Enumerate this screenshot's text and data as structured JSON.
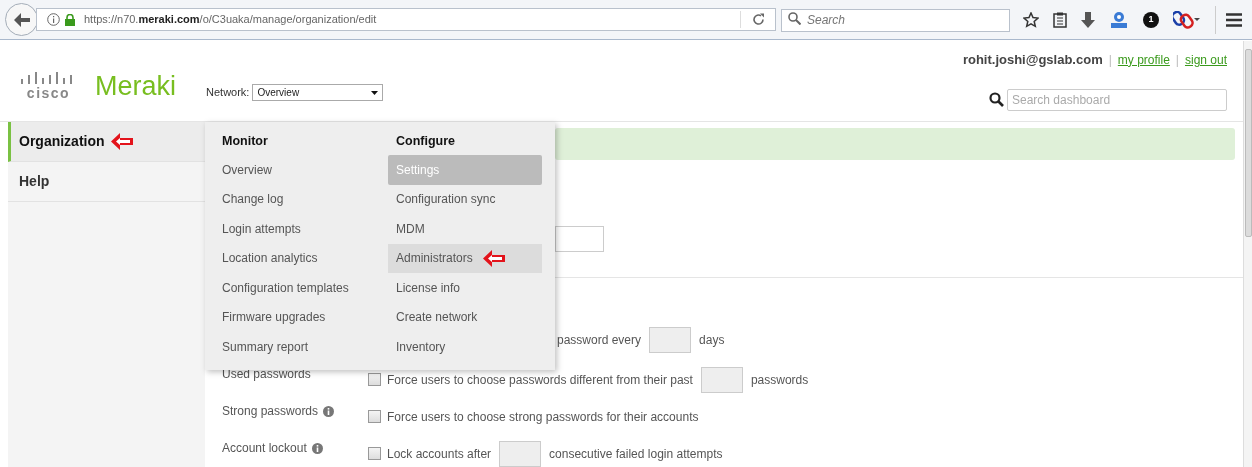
{
  "browser": {
    "url": "https://n70.**meraki.com**/o/C3uaka/manage/organization/edit",
    "search_placeholder": "Search",
    "badge": "1"
  },
  "header": {
    "logo_word": "cisco",
    "brand": "Meraki",
    "network_label": "Network:",
    "network_value": "Overview",
    "user": "rohit.joshi@gslab.com",
    "links": [
      {
        "separator": "|",
        "label": "my profile"
      },
      {
        "separator": "|",
        "label": "sign out"
      }
    ],
    "search_placeholder": "Search dashboard"
  },
  "sidebar": {
    "items": [
      {
        "label": "Organization",
        "selected": true,
        "annotated": true
      },
      {
        "label": "Help",
        "selected": false,
        "annotated": false
      }
    ]
  },
  "menu": {
    "columns": [
      {
        "heading": "Monitor",
        "items": [
          {
            "label": "Overview",
            "selected": false,
            "hovered": false,
            "annotated": false
          },
          {
            "label": "Change log",
            "selected": false,
            "hovered": false,
            "annotated": false
          },
          {
            "label": "Login attempts",
            "selected": false,
            "hovered": false,
            "annotated": false
          },
          {
            "label": "Location analytics",
            "selected": false,
            "hovered": false,
            "annotated": false
          },
          {
            "label": "Configuration templates",
            "selected": false,
            "hovered": false,
            "annotated": false
          },
          {
            "label": "Firmware upgrades",
            "selected": false,
            "hovered": false,
            "annotated": false
          },
          {
            "label": "Summary report",
            "selected": false,
            "hovered": false,
            "annotated": false
          }
        ]
      },
      {
        "heading": "Configure",
        "items": [
          {
            "label": "Settings",
            "selected": true,
            "hovered": false,
            "annotated": false
          },
          {
            "label": "Configuration sync",
            "selected": false,
            "hovered": false,
            "annotated": false
          },
          {
            "label": "MDM",
            "selected": false,
            "hovered": false,
            "annotated": false
          },
          {
            "label": "Administrators",
            "selected": false,
            "hovered": true,
            "annotated": true
          },
          {
            "label": "License info",
            "selected": false,
            "hovered": false,
            "annotated": false
          },
          {
            "label": "Create network",
            "selected": false,
            "hovered": false,
            "annotated": false
          },
          {
            "label": "Inventory",
            "selected": false,
            "hovered": false,
            "annotated": false
          }
        ]
      }
    ]
  },
  "settings": [
    {
      "kind": "partial",
      "text": "password every",
      "field": true,
      "suffix": "days"
    },
    {
      "kind": "option",
      "label": "Used passwords",
      "info": false,
      "checked": false,
      "text": "Force users to choose passwords different from their past",
      "field": true,
      "suffix": "passwords"
    },
    {
      "kind": "option",
      "label": "Strong passwords",
      "info": true,
      "checked": false,
      "text": "Force users to choose strong passwords for their accounts",
      "field": false
    },
    {
      "kind": "option",
      "label": "Account lockout",
      "info": true,
      "checked": false,
      "text": "Lock accounts after",
      "field": true,
      "suffix": "consecutive failed login attempts"
    }
  ]
}
